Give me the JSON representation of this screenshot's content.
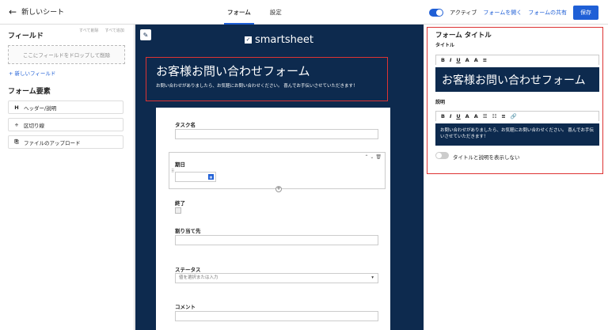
{
  "topbar": {
    "back_label": "新しいシート",
    "tabs": [
      {
        "label": "フォーム",
        "active": true
      },
      {
        "label": "設定",
        "active": false
      }
    ],
    "active_label": "アクティブ",
    "open_form": "フォームを開く",
    "share_form": "フォームの共有",
    "save": "保存"
  },
  "fields_panel": {
    "title": "フィールド",
    "delete_all": "すべて削除",
    "add_all": "すべて追加",
    "dropzone": "ここにフィールドをドロップして削除",
    "new_field": "+ 新しいフィールド",
    "elements_title": "フォーム要素",
    "elements": [
      {
        "icon": "H",
        "label": "ヘッダー/説明"
      },
      {
        "icon": "÷",
        "label": "区切り線"
      },
      {
        "icon": "⎘",
        "label": "ファイルのアップロード"
      }
    ]
  },
  "form": {
    "logo": "smartsheet",
    "title": "お客様お問い合わせフォーム",
    "description": "お問い合わせがありましたら、お気軽にお問い合わせください。 喜んでお手伝いさせていただきます！",
    "fields": {
      "task": "タスク名",
      "due": "期日",
      "done": "終了",
      "assigned": "割り当て先",
      "status": "ステータス",
      "status_placeholder": "値を選択または入力",
      "comment": "コメント"
    }
  },
  "props": {
    "title": "フォーム タイトル",
    "title_label": "タイトル",
    "title_value": "お客様お問い合わせフォーム",
    "desc_label": "説明",
    "desc_value": "お問い合わせがありましたら、お気軽にお問い合わせください。 喜んでお手伝いさせていただきます！",
    "toggle_label": "タイトルと説明を表示しない"
  },
  "colors": {
    "accent": "#1f5fd6",
    "navy": "#0d2a4e",
    "highlight": "#dd3333"
  }
}
